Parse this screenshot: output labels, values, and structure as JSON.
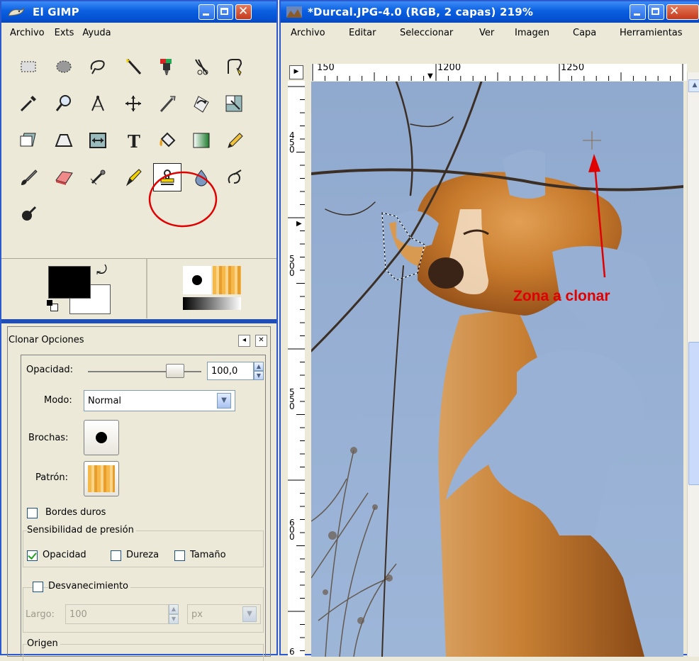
{
  "toolbox": {
    "title": "El GIMP",
    "menu": [
      {
        "label": "Archivo",
        "accel": "A"
      },
      {
        "label": "Exts",
        "accel": "x"
      },
      {
        "label": "Ayuda",
        "accel": "y"
      }
    ],
    "tools": [
      "rect-select",
      "ellipse-select",
      "free-select",
      "fuzzy-select",
      "color-select",
      "scissors",
      "paths",
      "color-picker",
      "zoom",
      "measure",
      "move",
      "crop",
      "rotate",
      "scale",
      "shear",
      "perspective",
      "flip",
      "text",
      "bucket-fill",
      "blend",
      "pencil",
      "paintbrush",
      "eraser",
      "airbrush",
      "ink",
      "clone",
      "blur",
      "smudge",
      "dodge-burn"
    ],
    "selected_tool": "clone",
    "fg_color": "#000000",
    "bg_color": "#FFFFFF"
  },
  "options": {
    "title": "Clonar Opciones",
    "opacity_label": "Opacidad:",
    "opacity_value": "100,0",
    "mode_label": "Modo:",
    "mode_value": "Normal",
    "brushes_label": "Brochas:",
    "pattern_label": "Patrón:",
    "hard_edges_label": "Bordes duros",
    "pressure_group": "Sensibilidad de presión",
    "pressure_opacity": "Opacidad",
    "pressure_hardness": "Dureza",
    "pressure_size": "Tamaño",
    "fade_label": "Desvanecimiento",
    "length_label": "Largo:",
    "length_value": "100",
    "unit_value": "px",
    "origin_label": "Origen"
  },
  "image_window": {
    "title": "*Durcal.JPG-4.0 (RGB, 2 capas) 219%",
    "menu": [
      "Archivo",
      "Editar",
      "Seleccionar",
      "Ver",
      "Imagen",
      "Capa",
      "Herramientas"
    ],
    "menu_accels": [
      "A",
      "E",
      "S",
      "V",
      "I",
      "C",
      "H"
    ],
    "hruler_labels": [
      "150",
      "1200",
      "1250"
    ],
    "vruler_labels": [
      "450",
      "500",
      "550",
      "600",
      "6"
    ],
    "annotation": "Zona a clonar"
  },
  "colors": {
    "title_blue": "#0A5FE0",
    "annotation_red": "#E00000",
    "sky": "#97AFD2",
    "dog": "#C9782A"
  }
}
